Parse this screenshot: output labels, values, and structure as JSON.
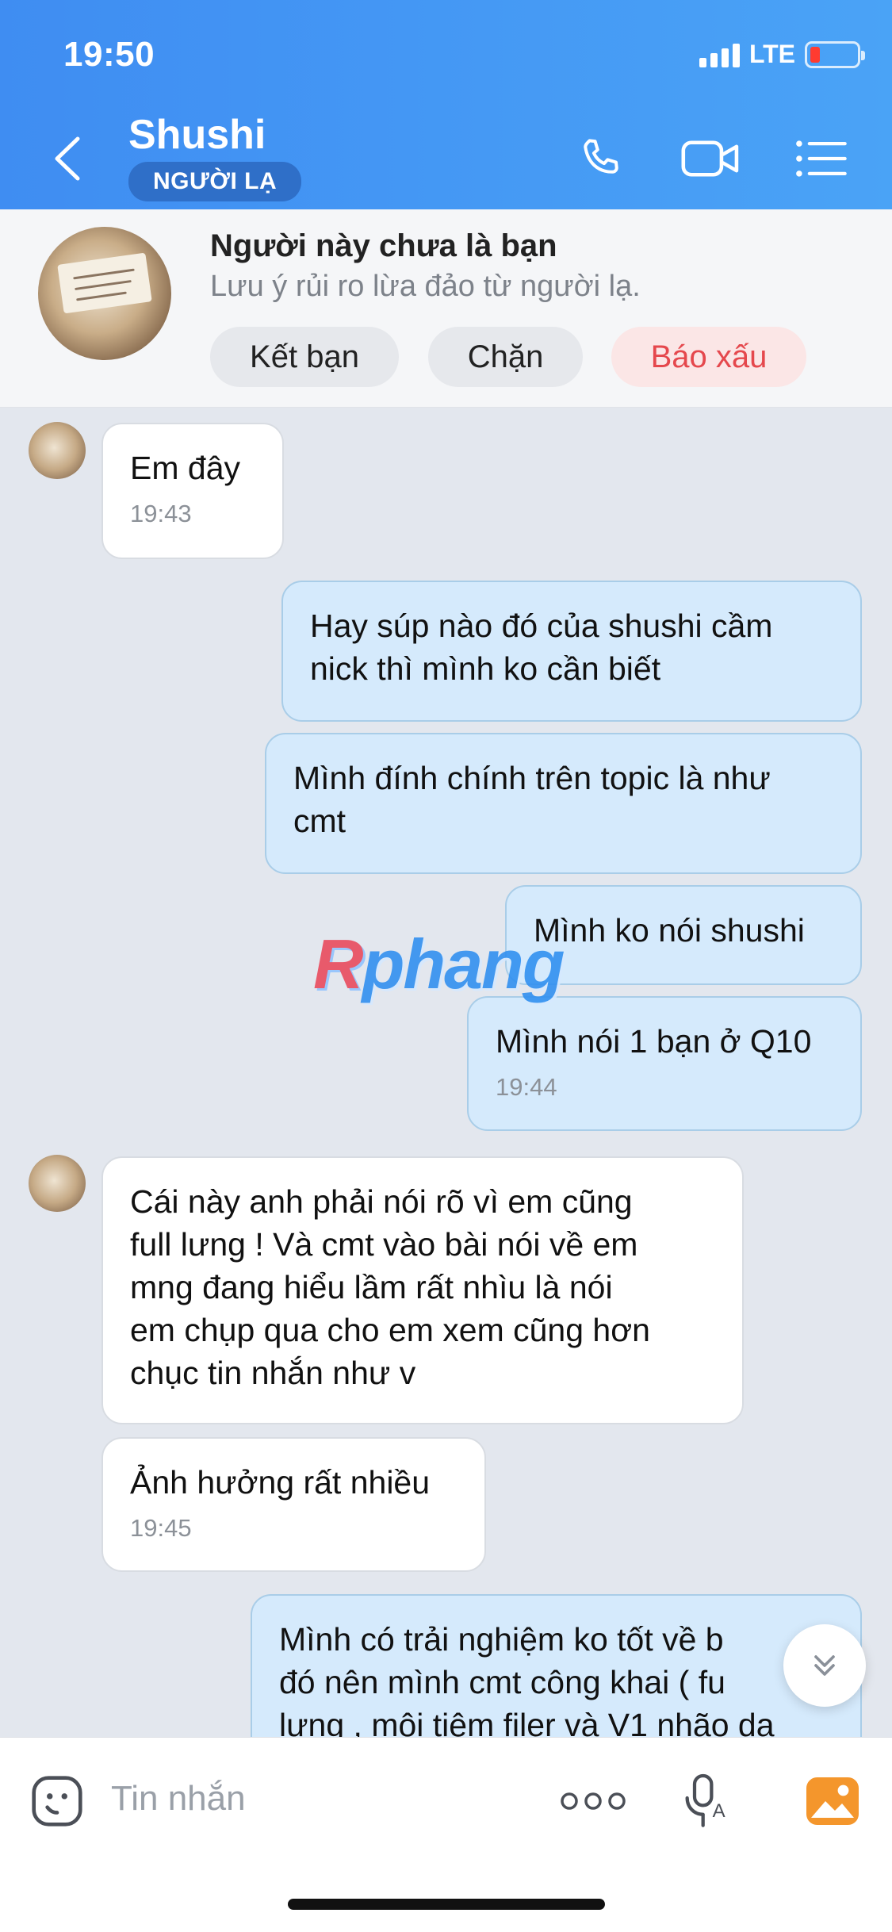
{
  "status_bar": {
    "time": "19:50",
    "network": "LTE"
  },
  "header": {
    "contact_name": "Shushi",
    "badge": "NGƯỜI LẠ",
    "icons": [
      "back-icon",
      "phone-icon",
      "video-call-icon",
      "menu-list-icon"
    ]
  },
  "banner": {
    "title": "Người này chưa là bạn",
    "subtitle": "Lưu ý rủi ro lừa đảo từ người lạ.",
    "add_friend": "Kết bạn",
    "block": "Chặn",
    "report": "Báo xấu"
  },
  "messages": [
    {
      "direction": "in",
      "text": "Em đây",
      "time": "19:43"
    },
    {
      "direction": "out",
      "text": "Hay súp nào đó của shushi cầm\nnick thì mình ko cần biết",
      "time": ""
    },
    {
      "direction": "out",
      "text": "Mình đính chính trên topic là như\ncmt",
      "time": ""
    },
    {
      "direction": "out",
      "text": "Mình ko nói shushi",
      "time": ""
    },
    {
      "direction": "out",
      "text": "Mình nói 1 bạn ở Q10",
      "time": "19:44"
    },
    {
      "direction": "in",
      "text": "Cái này anh phải nói rõ vì em cũng\nfull lưng ! Và cmt vào bài nói về em\nmng đang hiểu lầm rất nhìu là nói\nem chụp qua cho em xem cũng hơn\nchục tin nhắn như v",
      "time": ""
    },
    {
      "direction": "in",
      "text": "Ảnh hưởng rất nhiều",
      "time": "19:45"
    },
    {
      "direction": "out",
      "text": "Mình có trải nghiệm ko tốt về b\nđó nên mình cmt công khai ( fu\nlưng , môi tiêm filer và V1 nhão da",
      "time": ""
    }
  ],
  "watermark": {
    "part1": "R",
    "part2": "phang"
  },
  "input": {
    "placeholder": "Tin nhắn"
  },
  "colors": {
    "header_start": "#3f8df2",
    "header_end": "#4aa3f6",
    "outgoing_bubble": "#d5eafc",
    "incoming_bubble": "#ffffff",
    "report": "#e5484d"
  }
}
